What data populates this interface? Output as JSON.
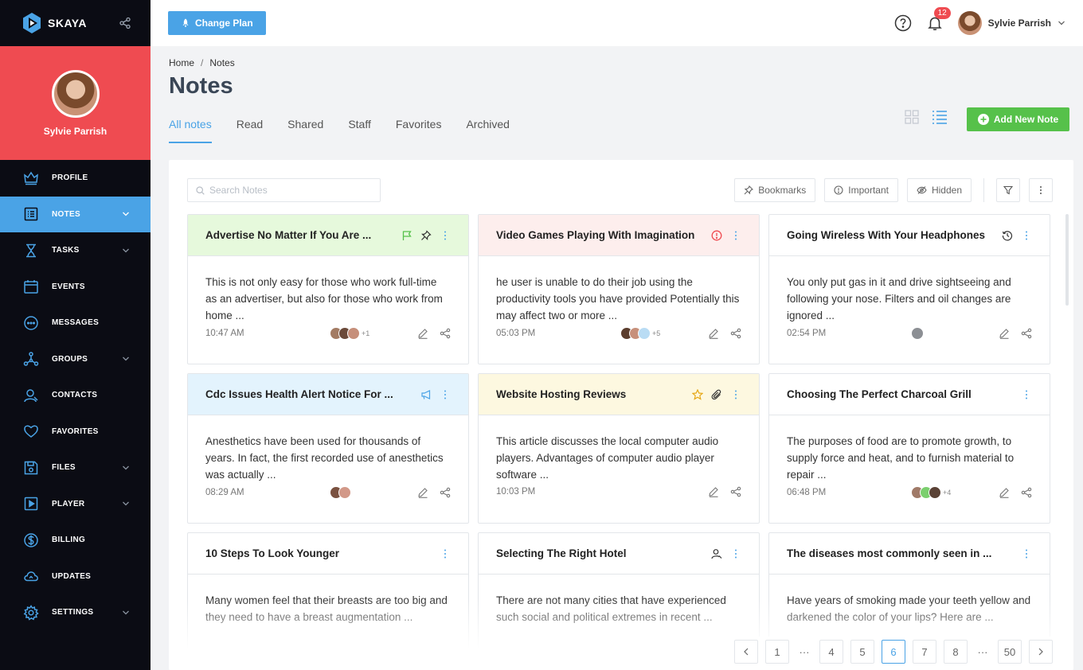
{
  "brand": {
    "name": "SKAYA"
  },
  "profile": {
    "name": "Sylvie Parrish"
  },
  "nav": [
    {
      "label": "PROFILE",
      "icon": "crown-icon",
      "chevron": false,
      "active": false
    },
    {
      "label": "NOTES",
      "icon": "notes-icon",
      "chevron": true,
      "active": true
    },
    {
      "label": "TASKS",
      "icon": "hourglass-icon",
      "chevron": true,
      "active": false
    },
    {
      "label": "EVENTS",
      "icon": "calendar-icon",
      "chevron": false,
      "active": false
    },
    {
      "label": "MESSAGES",
      "icon": "chat-icon",
      "chevron": false,
      "active": false
    },
    {
      "label": "GROUPS",
      "icon": "network-icon",
      "chevron": true,
      "active": false
    },
    {
      "label": "CONTACTS",
      "icon": "user-icon",
      "chevron": false,
      "active": false
    },
    {
      "label": "FAVORITES",
      "icon": "heart-icon",
      "chevron": false,
      "active": false
    },
    {
      "label": "FILES",
      "icon": "floppy-icon",
      "chevron": true,
      "active": false
    },
    {
      "label": "PLAYER",
      "icon": "play-icon",
      "chevron": true,
      "active": false
    },
    {
      "label": "BILLING",
      "icon": "dollar-icon",
      "chevron": false,
      "active": false
    },
    {
      "label": "UPDATES",
      "icon": "cloud-icon",
      "chevron": false,
      "active": false
    },
    {
      "label": "SETTINGS",
      "icon": "gear-icon",
      "chevron": true,
      "active": false
    }
  ],
  "topbar": {
    "plan_label": "Change Plan",
    "notification_count": "12",
    "user_name": "Sylvie Parrish"
  },
  "breadcrumb": {
    "home": "Home",
    "sep": "/",
    "current": "Notes"
  },
  "page_title": "Notes",
  "tabs": [
    "All notes",
    "Read",
    "Shared",
    "Staff",
    "Favorites",
    "Archived"
  ],
  "add_label": "Add New Note",
  "search": {
    "placeholder": "Search Notes"
  },
  "filters": {
    "bookmarks": "Bookmarks",
    "important": "Important",
    "hidden": "Hidden"
  },
  "colors": {
    "accent": "#4aa3e6",
    "danger": "#ef4b51",
    "success": "#56c14a",
    "sidebar": "#0b0c14"
  },
  "notes": [
    {
      "title": "Advertise No Matter If You Are ...",
      "body": "This is not only easy for those who work full-time as an advertiser, but also for those who work from home ...",
      "time": "10:47 AM",
      "extra": "+1",
      "bg": "green"
    },
    {
      "title": "Video Games Playing With Imagination",
      "body": "he user is unable to do their job using the productivity tools you have provided Potentially this may affect two or more ...",
      "time": "05:03 PM",
      "extra": "+5",
      "bg": "red"
    },
    {
      "title": "Going Wireless With Your Headphones",
      "body": "You only put gas in it and drive sightseeing and following your nose. Filters and oil changes are ignored ...",
      "time": "02:54 PM",
      "extra": "",
      "bg": "none"
    },
    {
      "title": "Cdc Issues Health Alert Notice For ...",
      "body": "Anesthetics have been used for thousands of years. In fact, the first recorded use of anesthetics was actually ...",
      "time": "08:29 AM",
      "extra": "",
      "bg": "blue"
    },
    {
      "title": "Website Hosting Reviews",
      "body": "This article discusses the local computer audio players. Advantages of computer audio player software ...",
      "time": "10:03 PM",
      "extra": "",
      "bg": "yellow"
    },
    {
      "title": "Choosing The Perfect Charcoal Grill",
      "body": "The purposes of food are to promote growth, to supply force and heat, and to furnish material to repair ...",
      "time": "06:48 PM",
      "extra": "+4",
      "bg": "none"
    },
    {
      "title": "10 Steps To Look Younger",
      "body": "Many women feel that their breasts are too big and they need to have a breast augmentation ...",
      "time": "",
      "extra": "",
      "bg": "none"
    },
    {
      "title": "Selecting The Right Hotel",
      "body": "There are not many cities that have experienced such social and political extremes in recent ...",
      "time": "",
      "extra": "",
      "bg": "none"
    },
    {
      "title": "The diseases most commonly seen in  ...",
      "body": "Have years of smoking made your teeth yellow and darkened the color of your lips? Here are ...",
      "time": "",
      "extra": "",
      "bg": "none"
    }
  ],
  "pagination": {
    "first": "1",
    "dots": "···",
    "p4": "4",
    "p5": "5",
    "p6": "6",
    "p7": "7",
    "p8": "8",
    "last": "50",
    "current": "6"
  }
}
